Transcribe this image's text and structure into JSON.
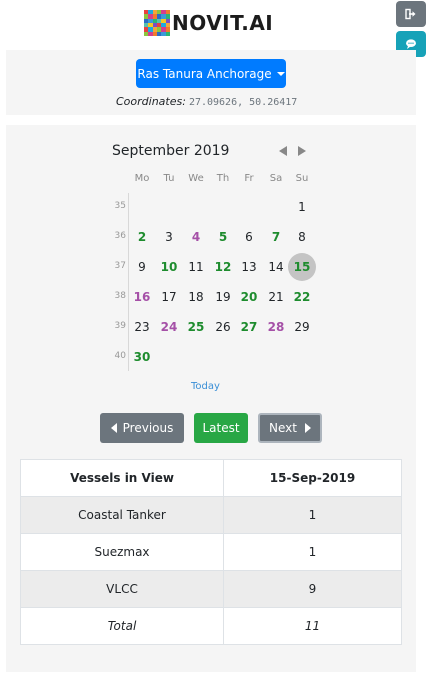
{
  "brand": {
    "name": "NOVIT.AI",
    "logo_icon": "color-grid-logo-icon"
  },
  "side_buttons": [
    {
      "name": "logout-button",
      "icon": "sign-out-icon",
      "color": "#6c757d"
    },
    {
      "name": "chat-button",
      "icon": "chat-bubble-icon",
      "color": "#17a2b8"
    }
  ],
  "location": {
    "dropdown_label": "Ras Tanura Anchorage",
    "coords_label": "Coordinates:",
    "coords_value": "27.09626, 50.26417"
  },
  "calendar": {
    "title": "September 2019",
    "days_of_week": [
      "Mo",
      "Tu",
      "We",
      "Th",
      "Fr",
      "Sa",
      "Su"
    ],
    "weeks": [
      {
        "num": "35",
        "days": [
          "",
          "",
          "",
          "",
          "",
          "",
          "1"
        ]
      },
      {
        "num": "36",
        "days": [
          "2",
          "3",
          "4",
          "5",
          "6",
          "7",
          "8"
        ]
      },
      {
        "num": "37",
        "days": [
          "9",
          "10",
          "11",
          "12",
          "13",
          "14",
          "15"
        ]
      },
      {
        "num": "38",
        "days": [
          "16",
          "17",
          "18",
          "19",
          "20",
          "21",
          "22"
        ]
      },
      {
        "num": "39",
        "days": [
          "23",
          "24",
          "25",
          "26",
          "27",
          "28",
          "29"
        ]
      },
      {
        "num": "40",
        "days": [
          "30",
          "",
          "",
          "",
          "",
          "",
          ""
        ]
      }
    ],
    "green_days": [
      "2",
      "5",
      "7",
      "10",
      "12",
      "15",
      "20",
      "22",
      "25",
      "27",
      "30"
    ],
    "purple_days": [
      "4",
      "16",
      "24",
      "28"
    ],
    "selected_day": "15",
    "today_label": "Today",
    "colors": {
      "green": "#1e8c2e",
      "purple": "#a550a7"
    }
  },
  "buttons": {
    "previous": "Previous",
    "latest": "Latest",
    "next": "Next"
  },
  "table": {
    "headers": [
      "Vessels in View",
      "15-Sep-2019"
    ],
    "rows": [
      [
        "Coastal Tanker",
        "1"
      ],
      [
        "Suezmax",
        "1"
      ],
      [
        "VLCC",
        "9"
      ]
    ],
    "total": [
      "Total",
      "11"
    ]
  }
}
